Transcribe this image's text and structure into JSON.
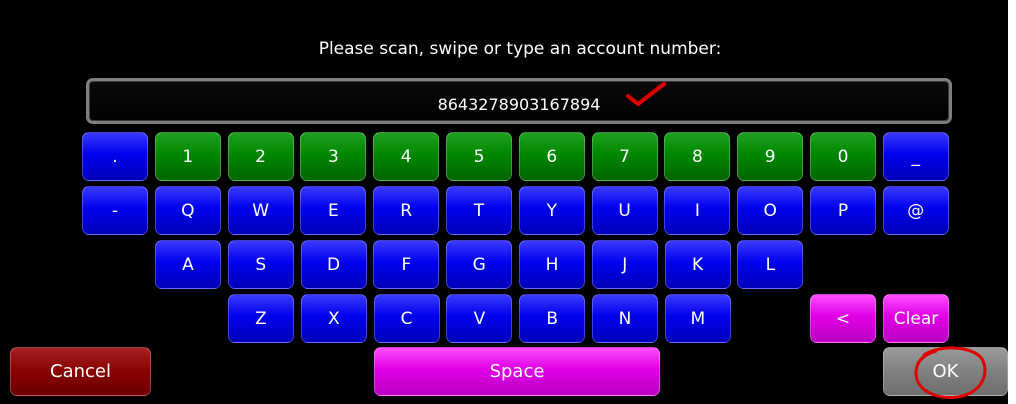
{
  "prompt": "Please scan, swipe or type an account number:",
  "account_number": "8643278903167894",
  "keyboard": {
    "row1": [
      {
        "label": ".",
        "color": "blue"
      },
      {
        "label": "1",
        "color": "green"
      },
      {
        "label": "2",
        "color": "green"
      },
      {
        "label": "3",
        "color": "green"
      },
      {
        "label": "4",
        "color": "green"
      },
      {
        "label": "5",
        "color": "green"
      },
      {
        "label": "6",
        "color": "green"
      },
      {
        "label": "7",
        "color": "green"
      },
      {
        "label": "8",
        "color": "green"
      },
      {
        "label": "9",
        "color": "green"
      },
      {
        "label": "0",
        "color": "green"
      },
      {
        "label": "_",
        "color": "blue"
      }
    ],
    "row2": [
      {
        "label": "-",
        "color": "blue"
      },
      {
        "label": "Q",
        "color": "blue"
      },
      {
        "label": "W",
        "color": "blue"
      },
      {
        "label": "E",
        "color": "blue"
      },
      {
        "label": "R",
        "color": "blue"
      },
      {
        "label": "T",
        "color": "blue"
      },
      {
        "label": "Y",
        "color": "blue"
      },
      {
        "label": "U",
        "color": "blue"
      },
      {
        "label": "I",
        "color": "blue"
      },
      {
        "label": "O",
        "color": "blue"
      },
      {
        "label": "P",
        "color": "blue"
      },
      {
        "label": "@",
        "color": "blue"
      }
    ],
    "row3": [
      {
        "label": "A",
        "color": "blue"
      },
      {
        "label": "S",
        "color": "blue"
      },
      {
        "label": "D",
        "color": "blue"
      },
      {
        "label": "F",
        "color": "blue"
      },
      {
        "label": "G",
        "color": "blue"
      },
      {
        "label": "H",
        "color": "blue"
      },
      {
        "label": "J",
        "color": "blue"
      },
      {
        "label": "K",
        "color": "blue"
      },
      {
        "label": "L",
        "color": "blue"
      }
    ],
    "row4": [
      {
        "label": "Z",
        "color": "blue"
      },
      {
        "label": "X",
        "color": "blue"
      },
      {
        "label": "C",
        "color": "blue"
      },
      {
        "label": "V",
        "color": "blue"
      },
      {
        "label": "B",
        "color": "blue"
      },
      {
        "label": "N",
        "color": "blue"
      },
      {
        "label": "M",
        "color": "blue"
      }
    ],
    "backspace_label": "<",
    "clear_label": "Clear"
  },
  "buttons": {
    "cancel": "Cancel",
    "space": "Space",
    "ok": "OK"
  },
  "colors": {
    "background": "#000000",
    "key_blue": "#0000ee",
    "key_green": "#008800",
    "key_pink": "#e000e6",
    "cancel": "#880000",
    "ok": "#808080",
    "annotation_red": "#e00000"
  }
}
